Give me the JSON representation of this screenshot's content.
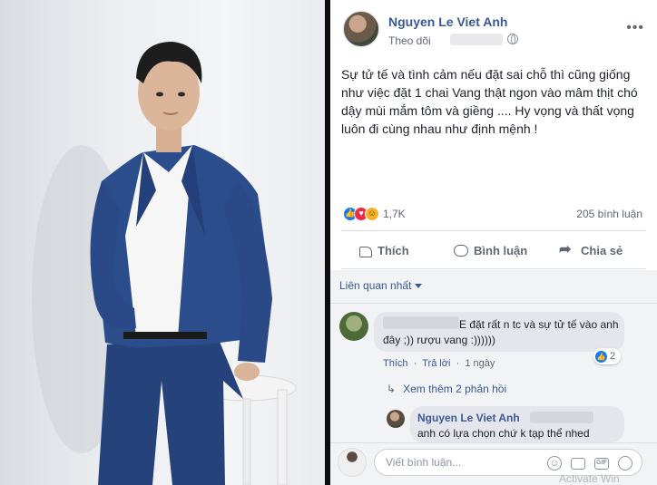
{
  "post": {
    "author": "Nguyen Le Viet Anh",
    "follow_label": "Theo dõi",
    "text": "Sự tử tế và tình cảm nếu đặt sai chỗ thì cũng giống như việc đặt 1 chai Vang thật ngon vào mâm thịt chó dậy mùi mắm tôm và giềng .... Hy vọng và thất vọng luôn đi cùng nhau như định mệnh !",
    "reaction_count": "1,7K",
    "comment_count": "205 bình luận"
  },
  "actions": {
    "like": "Thích",
    "comment": "Bình luận",
    "share": "Chia sẻ"
  },
  "comments": {
    "sort_label": "Liên quan nhất",
    "first": {
      "text": "E đặt rất n tc và sự tử tế vào anh đây ;)) rượu vang :))))))",
      "like_count": "2",
      "like_action": "Thích",
      "reply_action": "Trả lời",
      "time": "1 ngày"
    },
    "more_replies": "Xem thêm 2 phản hồi",
    "reply": {
      "author": "Nguyen Le Viet Anh",
      "text": "anh có lựa chọn chứ k tạp thể nhed"
    },
    "composer_placeholder": "Viết bình luận...",
    "watermark": "Activate Win"
  },
  "colors": {
    "link": "#385898",
    "like": "#1877f2",
    "love": "#f02849",
    "haha": "#f7b125"
  },
  "icons": [
    "thumbs-up-icon",
    "comment-icon",
    "share-icon",
    "globe-icon",
    "more-icon",
    "emoji-icon",
    "camera-icon",
    "gif-icon",
    "sticker-icon"
  ]
}
